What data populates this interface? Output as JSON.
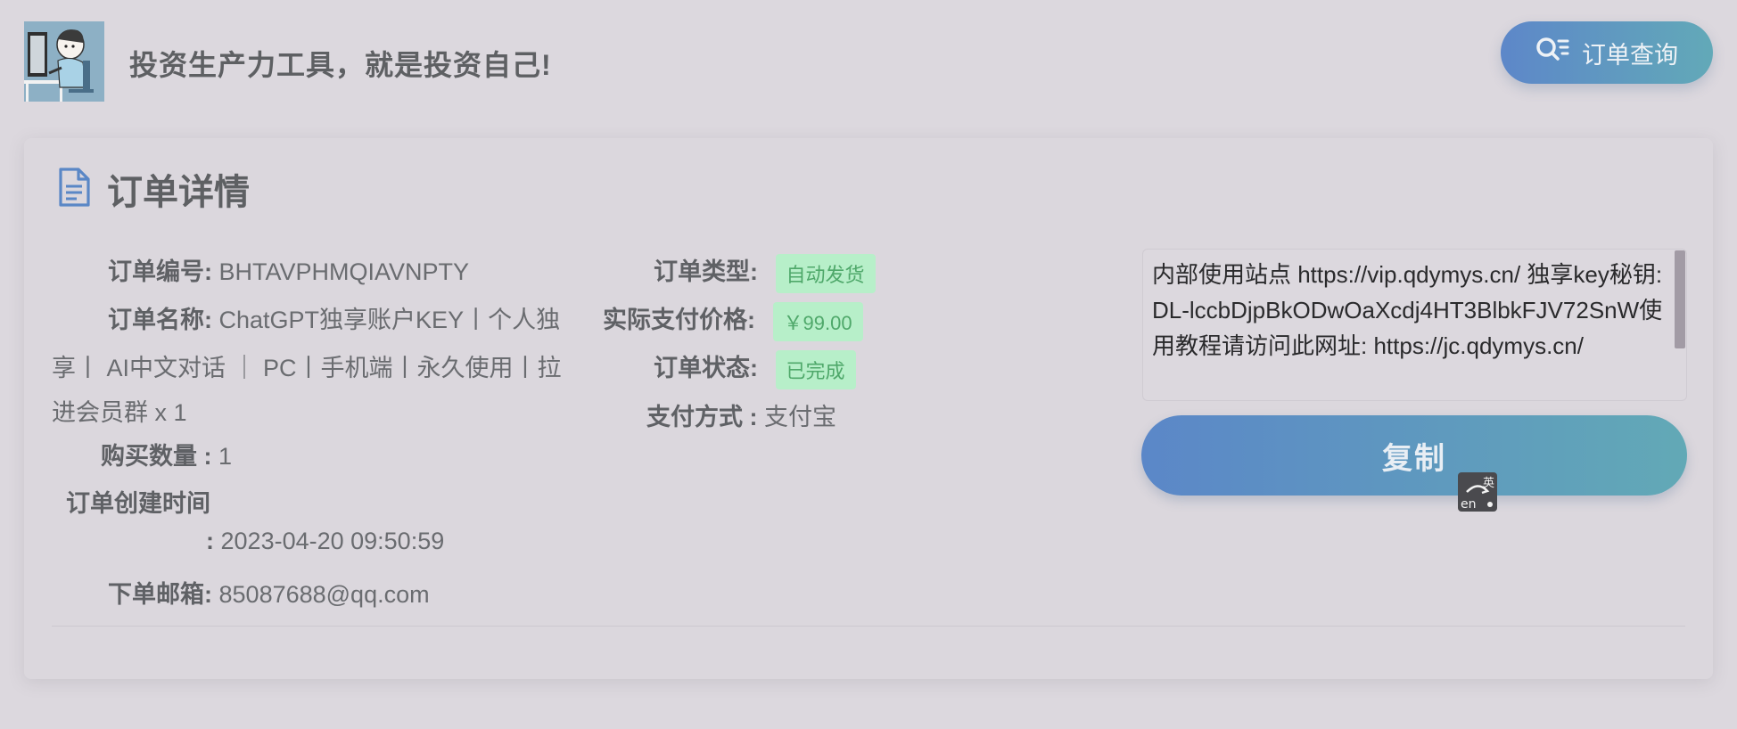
{
  "header": {
    "slogan": "投资生产力工具，就是投资自己!",
    "query_button": "订单查询"
  },
  "card": {
    "title": "订单详情",
    "order_no_label": "订单编号:",
    "order_no_value": "BHTAVPHMQIAVNPTY",
    "order_name_label": "订单名称:",
    "order_name_line1": "ChatGPT独享账户KEY丨个人独",
    "order_name_line2": "享丨 AI中文对话 ｜ PC丨手机端丨永久使用丨拉",
    "order_name_line3": "进会员群 x 1",
    "quantity_label": "购买数量 :",
    "quantity_value": "1",
    "created_label": "订单创建时间",
    "created_colon": ":",
    "created_value": "2023-04-20 09:50:59",
    "email_label": "下单邮箱:",
    "email_value": "85087688@qq.com",
    "type_label": "订单类型:",
    "type_value": "自动发货",
    "price_label": "实际支付价格:",
    "price_value": "￥99.00",
    "status_label": "订单状态:",
    "status_value": "已完成",
    "payment_label": "支付方式 :",
    "payment_value": "支付宝",
    "key_text": "内部使用站点 https://vip.qdymys.cn/ 独享key秘钥:DL-lccbDjpBkODwOaXcdj4HT3BlbkFJV72SnW使用教程请访问此网址: https://jc.qdymys.cn/",
    "copy_button": "复制"
  },
  "ime_badge": {
    "top": "英",
    "bottom": "en"
  },
  "colors": {
    "accent_start": "#5b87c8",
    "accent_end": "#62a9b6",
    "tag_bg": "#b7efc9",
    "tag_text": "#4fa86a"
  },
  "icons": {
    "logo": "cartoon-programmer-logo",
    "query": "search-list-icon",
    "title": "document-icon",
    "ime": "ime-switch-icon"
  }
}
